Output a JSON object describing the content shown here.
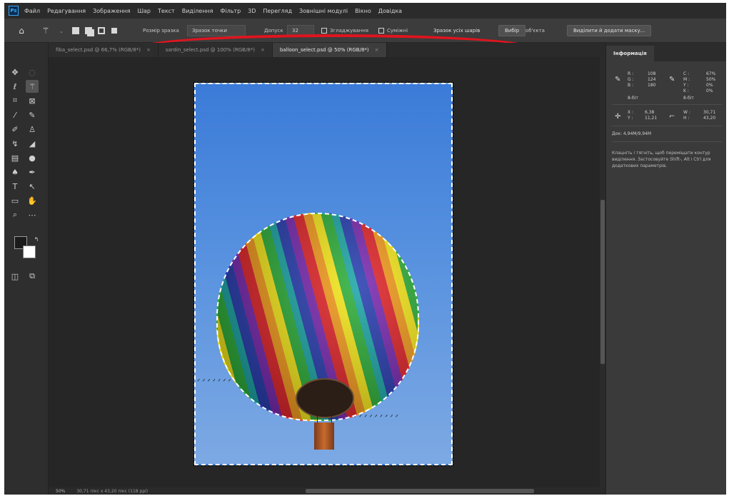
{
  "app": {
    "logo": "Ps"
  },
  "menu": [
    "Файл",
    "Редагування",
    "Зображення",
    "Шар",
    "Текст",
    "Виділення",
    "Фільтр",
    "3D",
    "Перегляд",
    "Зовнішні модулі",
    "Вікно",
    "Довідка"
  ],
  "options": {
    "sample_size_label": "Розмір зразка",
    "sample_size_value": "Зразок точки",
    "tolerance_label": "Допуск",
    "tolerance_value": "32",
    "antialias_label": "Згладжування",
    "contiguous_label": "Суміжні",
    "sample_all_layers_label": "Зразок усіх шарів",
    "select_subject_label": "Вибір",
    "subject_label": "об'єкта",
    "select_mask_label": "Виділити й додати маску..."
  },
  "tabs": [
    {
      "label": "fiba_select.psd @ 66,7% (RGB/8*)",
      "active": false
    },
    {
      "label": "sardin_select.psd @ 100% (RGB/8*)",
      "active": false
    },
    {
      "label": "balloon_select.psd @ 50% (RGB/8*)",
      "active": true
    }
  ],
  "info_panel": {
    "tab_label": "Інформація",
    "rgb": {
      "R": "108",
      "G": "124",
      "B": "180"
    },
    "cmyk": {
      "C": "67%",
      "M": "50%",
      "Y": "0%",
      "K": "0%"
    },
    "bit_depth_left": "8-біт",
    "bit_depth_right": "8-біт",
    "coords": {
      "X": "6,38",
      "Y": "11,21"
    },
    "size": {
      "W": "30,71",
      "H": "43,20"
    },
    "doc_size": "Док: 4,94M/9,94M",
    "description": "Клацніть і тягніть, щоб переміщати контур виділення. Застосовуйте Shift-, Alt і Ctrl для додаткових параметрів."
  },
  "status": {
    "zoom": "50%",
    "doc_info": "30,71 пікс x 43,20 пікс (118 ppi)"
  },
  "colors": {
    "highlight": "#e0141e",
    "accent": "#31a8ff"
  }
}
